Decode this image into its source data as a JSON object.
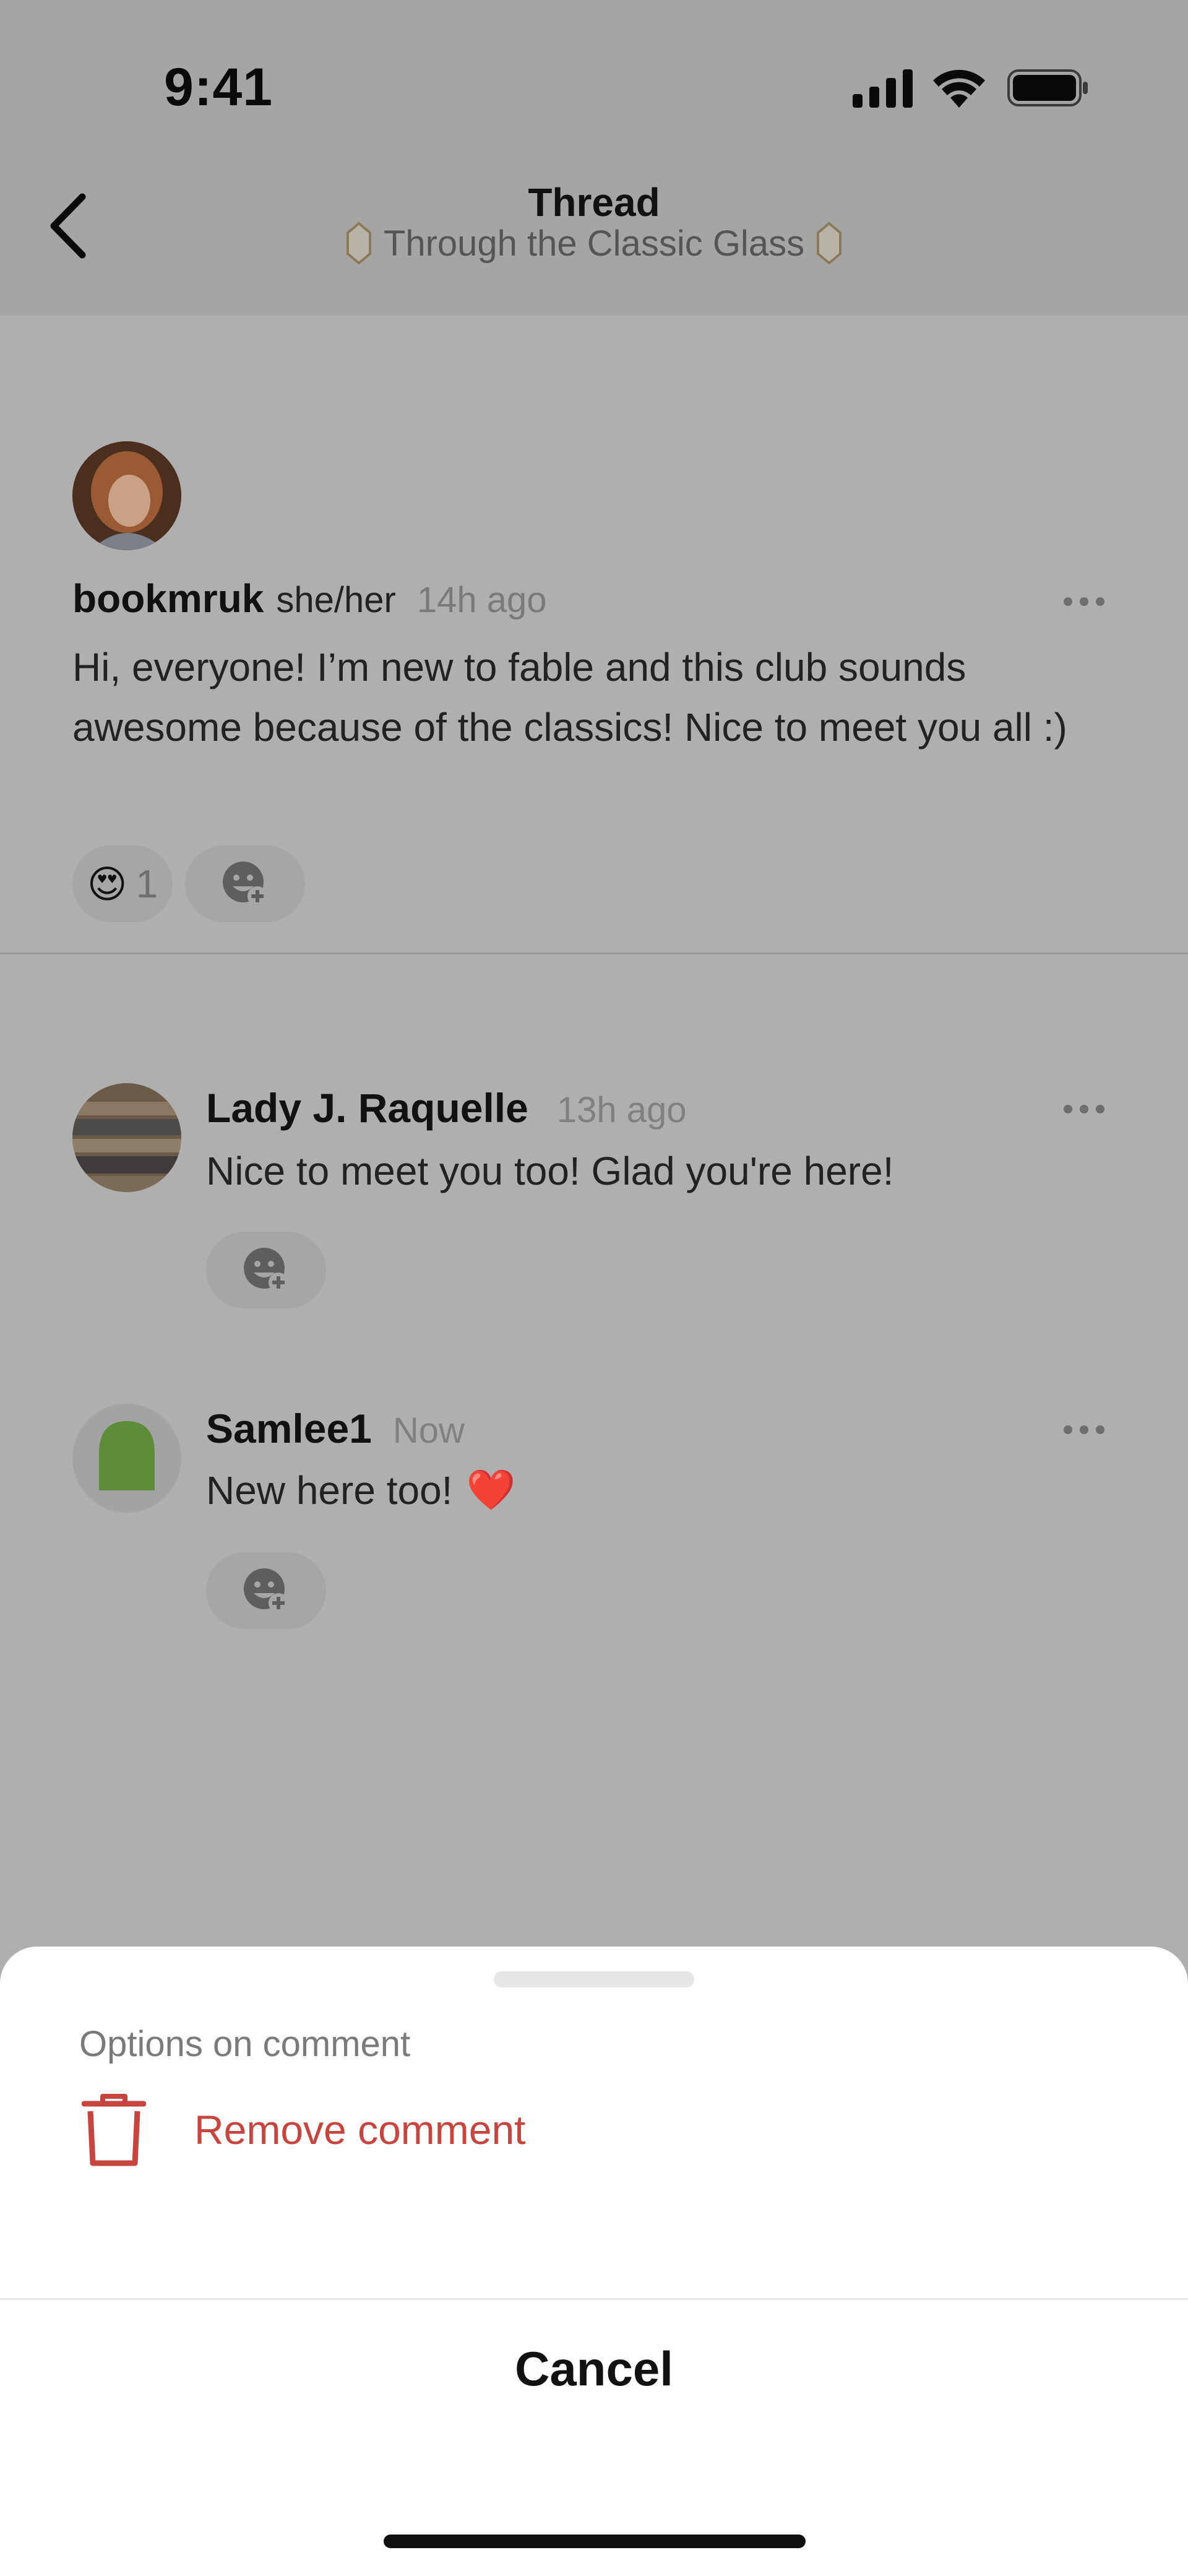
{
  "status_bar": {
    "time": "9:41"
  },
  "header": {
    "title": "Thread",
    "subtitle": "Through the Classic Glass"
  },
  "post": {
    "username": "bookmruk",
    "pronouns": "she/her",
    "time": "14h ago",
    "body": "Hi, everyone! I’m new to fable and this club sounds awesome because of the classics! Nice to meet you all :)",
    "reaction": {
      "emoji": "😍",
      "count": "1"
    }
  },
  "comments": [
    {
      "username": "Lady J. Raquelle",
      "time": "13h ago",
      "text": "Nice to meet you too! Glad you're here!",
      "emoji": ""
    },
    {
      "username": "Samlee1",
      "time": "Now",
      "text": "New here too!",
      "emoji": "❤️"
    }
  ],
  "sheet": {
    "title": "Options on comment",
    "remove_label": "Remove comment",
    "cancel_label": "Cancel"
  },
  "colors": {
    "destructive": "#c8453f",
    "overlay": "#afafaf",
    "avatar_green": "#5e8c3a"
  }
}
